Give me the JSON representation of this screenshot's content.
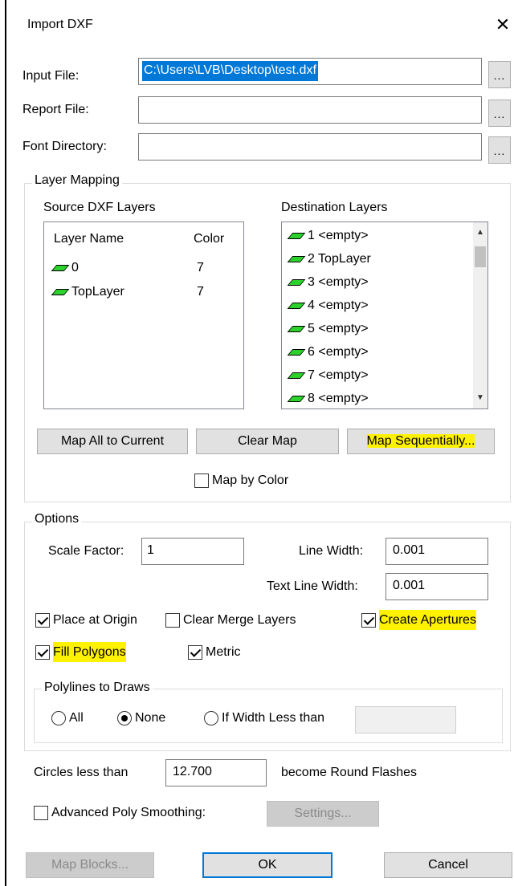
{
  "window": {
    "title": "Import DXF",
    "close_glyph": "✕"
  },
  "files": {
    "input_label": "Input File:",
    "input_value": "C:\\Users\\LVB\\Desktop\\test.dxf",
    "report_label": "Report File:",
    "report_value": "",
    "font_label": "Font Directory:",
    "font_value": "",
    "browse_label": "..."
  },
  "layer_mapping": {
    "title": "Layer Mapping",
    "source_title": "Source DXF Layers",
    "dest_title": "Destination Layers",
    "source_headers": {
      "name": "Layer Name",
      "color": "Color"
    },
    "source_rows": [
      {
        "name": "0",
        "color": "7"
      },
      {
        "name": "TopLayer",
        "color": "7"
      }
    ],
    "dest_rows": [
      "1 <empty>",
      "2 TopLayer",
      "3 <empty>",
      "4 <empty>",
      "5 <empty>",
      "6 <empty>",
      "7 <empty>",
      "8 <empty>"
    ],
    "buttons": {
      "map_all": "Map All to Current",
      "clear_map": "Clear Map",
      "map_seq": "Map Sequentially..."
    },
    "map_by_color": "Map by Color"
  },
  "options": {
    "title": "Options",
    "scale_label": "Scale Factor:",
    "scale_value": "1",
    "line_width_label": "Line Width:",
    "line_width_value": "0.001",
    "text_line_width_label": "Text Line Width:",
    "text_line_width_value": "0.001",
    "place_origin": "Place at Origin",
    "clear_merge": "Clear Merge Layers",
    "create_apertures": "Create Apertures",
    "fill_polygons": "Fill Polygons",
    "metric": "Metric",
    "polylines": {
      "title": "Polylines to Draws",
      "all": "All",
      "none": "None",
      "width_less": "If Width Less than",
      "width_value": ""
    },
    "circles_label": "Circles less than",
    "circles_value": "12.700",
    "circles_suffix": "become Round Flashes",
    "adv_poly": "Advanced Poly Smoothing:",
    "settings": "Settings..."
  },
  "footer": {
    "map_blocks": "Map Blocks...",
    "ok": "OK",
    "cancel": "Cancel"
  },
  "colors": {
    "accent": "#0078d7",
    "highlight": "#fff200",
    "layer_icon": "#2cd12c"
  }
}
